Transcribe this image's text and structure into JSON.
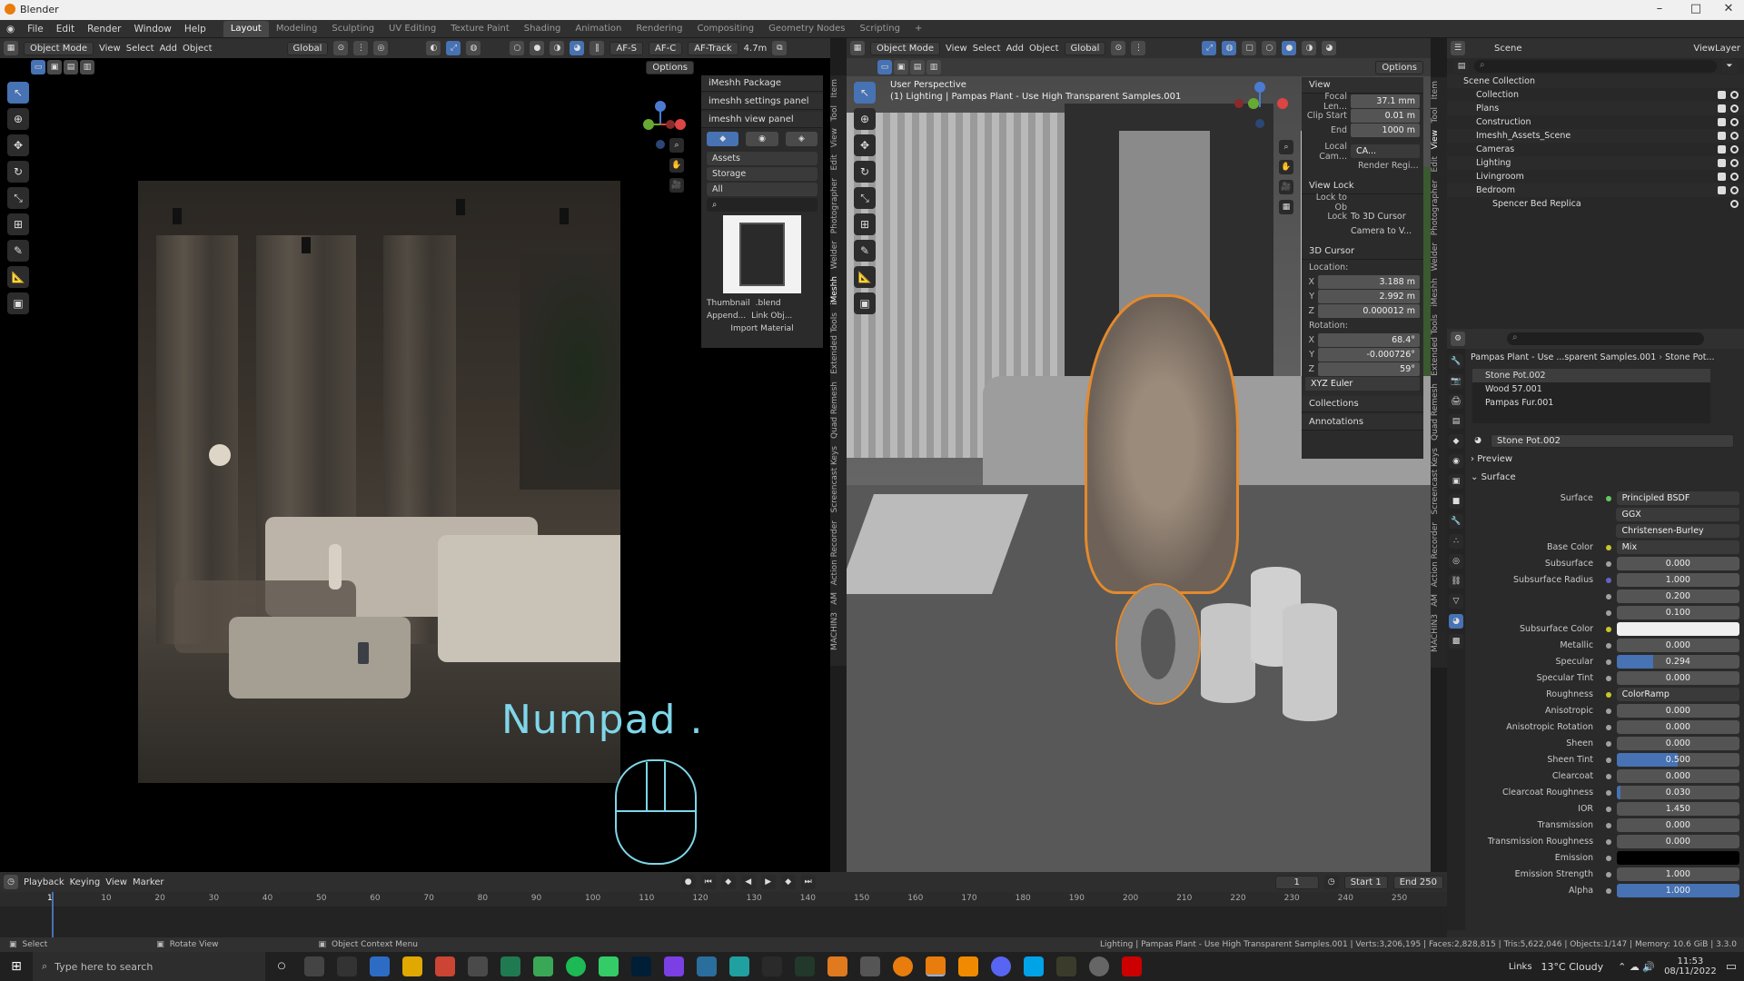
{
  "app": {
    "title": "Blender"
  },
  "menu": {
    "items": [
      "File",
      "Edit",
      "Render",
      "Window",
      "Help"
    ],
    "workspaces": [
      "Layout",
      "Modeling",
      "Sculpting",
      "UV Editing",
      "Texture Paint",
      "Shading",
      "Animation",
      "Rendering",
      "Compositing",
      "Geometry Nodes",
      "Scripting"
    ],
    "active_workspace": "Layout",
    "add_tab": "+"
  },
  "left_viewport": {
    "mode": "Object Mode",
    "menus": [
      "View",
      "Select",
      "Add",
      "Object"
    ],
    "orientation": "Global",
    "af_s": "AF-S",
    "af_c": "AF-C",
    "af_track": "AF-Track",
    "focal": "4.7m",
    "options": "Options",
    "overlay_text": "Numpad ."
  },
  "imeshh": {
    "panels": [
      "iMeshh Package",
      "imeshh settings panel",
      "imeshh view panel"
    ],
    "dropdowns": [
      "Assets",
      "Storage",
      "All"
    ],
    "thumbnail_label": "Thumbnail",
    "blend_label": ".blend",
    "append_label": "Append...",
    "link_label": "Link Obj...",
    "import_label": "Import Material",
    "side_tabs": [
      "Item",
      "Tool",
      "View",
      "Edit",
      "Photographer",
      "Welder",
      "iMeshh",
      "Extended Tools",
      "Quad Remesh",
      "Screencast Keys",
      "Action Recorder",
      "AM",
      "MACHIN3"
    ]
  },
  "right_viewport": {
    "mode": "Object Mode",
    "menus": [
      "View",
      "Select",
      "Add",
      "Object"
    ],
    "orientation": "Global",
    "options": "Options",
    "perspective": "User Perspective",
    "collection_path": "(1) Lighting | Pampas Plant - Use High Transparent Samples.001"
  },
  "view_panel": {
    "title": "View",
    "focal_label": "Focal Len...",
    "focal_value": "37.1 mm",
    "clip_start_label": "Clip Start",
    "clip_start_value": "0.01 m",
    "end_label": "End",
    "end_value": "1000 m",
    "local_cam_label": "Local Cam...",
    "local_cam_value": "CA...",
    "render_region": "Render Regi...",
    "view_lock": "View Lock",
    "lock_to_ob": "Lock to Ob",
    "lock": "Lock",
    "to_3d_cursor": "To 3D Cursor",
    "camera_to_v": "Camera to V...",
    "cursor_title": "3D Cursor",
    "location": "Location:",
    "loc_x": "3.188 m",
    "loc_y": "2.992 m",
    "loc_z": "0.000012 m",
    "rotation": "Rotation:",
    "rot_x": "68.4°",
    "rot_y": "-0.000726°",
    "rot_z": "59°",
    "rot_mode": "XYZ Euler",
    "collections": "Collections",
    "annotations": "Annotations",
    "axis_x": "X",
    "axis_y": "Y",
    "axis_z": "Z",
    "side_tabs": [
      "Item",
      "Tool",
      "View",
      "Edit",
      "Photographer",
      "Welder",
      "iMeshh",
      "Extended Tools",
      "Quad Remesh",
      "Screencast Keys",
      "Action Recorder",
      "AM",
      "MACHIN3"
    ]
  },
  "outliner": {
    "scene_label": "Scene",
    "view_layer": "ViewLayer",
    "items": [
      {
        "name": "Scene Collection",
        "indent": 0
      },
      {
        "name": "Collection",
        "indent": 1
      },
      {
        "name": "Plans",
        "indent": 1
      },
      {
        "name": "Construction",
        "indent": 1
      },
      {
        "name": "Imeshh_Assets_Scene",
        "indent": 1
      },
      {
        "name": "Cameras",
        "indent": 1
      },
      {
        "name": "Lighting",
        "indent": 1
      },
      {
        "name": "Livingroom",
        "indent": 1
      },
      {
        "name": "Bedroom",
        "indent": 1
      },
      {
        "name": "Spencer Bed Replica",
        "indent": 2
      }
    ]
  },
  "properties": {
    "breadcrumb_object": "Pampas Plant - Use ...sparent Samples.001",
    "breadcrumb_material": "Stone Pot...",
    "slots": [
      "Stone Pot.002",
      "Wood 57.001",
      "Pampas Fur.001"
    ],
    "material_name": "Stone Pot.002",
    "preview": "Preview",
    "surface_section": "Surface",
    "surface_label": "Surface",
    "surface_value": "Principled BSDF",
    "distribution": "GGX",
    "subsurface_method": "Christensen-Burley",
    "rows": [
      {
        "label": "Base Color",
        "value": "Mix",
        "fill": 0,
        "kind": "link"
      },
      {
        "label": "Subsurface",
        "value": "0.000",
        "fill": 0
      },
      {
        "label": "Subsurface Radius",
        "value": "1.000",
        "fill": 0
      },
      {
        "label": "",
        "value": "0.200",
        "fill": 0
      },
      {
        "label": "",
        "value": "0.100",
        "fill": 0
      },
      {
        "label": "Subsurface Color",
        "value": "",
        "fill": 0,
        "kind": "white"
      },
      {
        "label": "Metallic",
        "value": "0.000",
        "fill": 0
      },
      {
        "label": "Specular",
        "value": "0.294",
        "fill": 0.294
      },
      {
        "label": "Specular Tint",
        "value": "0.000",
        "fill": 0
      },
      {
        "label": "Roughness",
        "value": "ColorRamp",
        "fill": 0,
        "kind": "link"
      },
      {
        "label": "Anisotropic",
        "value": "0.000",
        "fill": 0
      },
      {
        "label": "Anisotropic Rotation",
        "value": "0.000",
        "fill": 0
      },
      {
        "label": "Sheen",
        "value": "0.000",
        "fill": 0
      },
      {
        "label": "Sheen Tint",
        "value": "0.500",
        "fill": 0.5
      },
      {
        "label": "Clearcoat",
        "value": "0.000",
        "fill": 0
      },
      {
        "label": "Clearcoat Roughness",
        "value": "0.030",
        "fill": 0.03
      },
      {
        "label": "IOR",
        "value": "1.450",
        "fill": 0
      },
      {
        "label": "Transmission",
        "value": "0.000",
        "fill": 0
      },
      {
        "label": "Transmission Roughness",
        "value": "0.000",
        "fill": 0
      },
      {
        "label": "Emission",
        "value": "",
        "fill": 0,
        "kind": "black"
      },
      {
        "label": "Emission Strength",
        "value": "1.000",
        "fill": 0
      },
      {
        "label": "Alpha",
        "value": "1.000",
        "fill": 1
      }
    ]
  },
  "timeline": {
    "menus": [
      "Playback",
      "Keying",
      "View",
      "Marker"
    ],
    "current_frame": "1",
    "start_label": "Start",
    "start": "1",
    "end_label": "End",
    "end": "250",
    "ticks": [
      "1",
      "10",
      "20",
      "30",
      "40",
      "50",
      "60",
      "70",
      "80",
      "90",
      "100",
      "110",
      "120",
      "130",
      "140",
      "150",
      "160",
      "170",
      "180",
      "190",
      "200",
      "210",
      "220",
      "230",
      "240",
      "250"
    ]
  },
  "status": {
    "select": "Select",
    "rotate": "Rotate View",
    "context_menu": "Object Context Menu",
    "stats": "Lighting | Pampas Plant - Use High Transparent Samples.001 | Verts:3,206,195 | Faces:2,828,815 | Tris:5,622,046 | Objects:1/147 | Memory: 10.6 GiB | 3.3.0"
  },
  "taskbar": {
    "search_placeholder": "Type here to search",
    "links": "Links",
    "weather": "13°C Cloudy",
    "time": "11:53",
    "date": "08/11/2022"
  }
}
